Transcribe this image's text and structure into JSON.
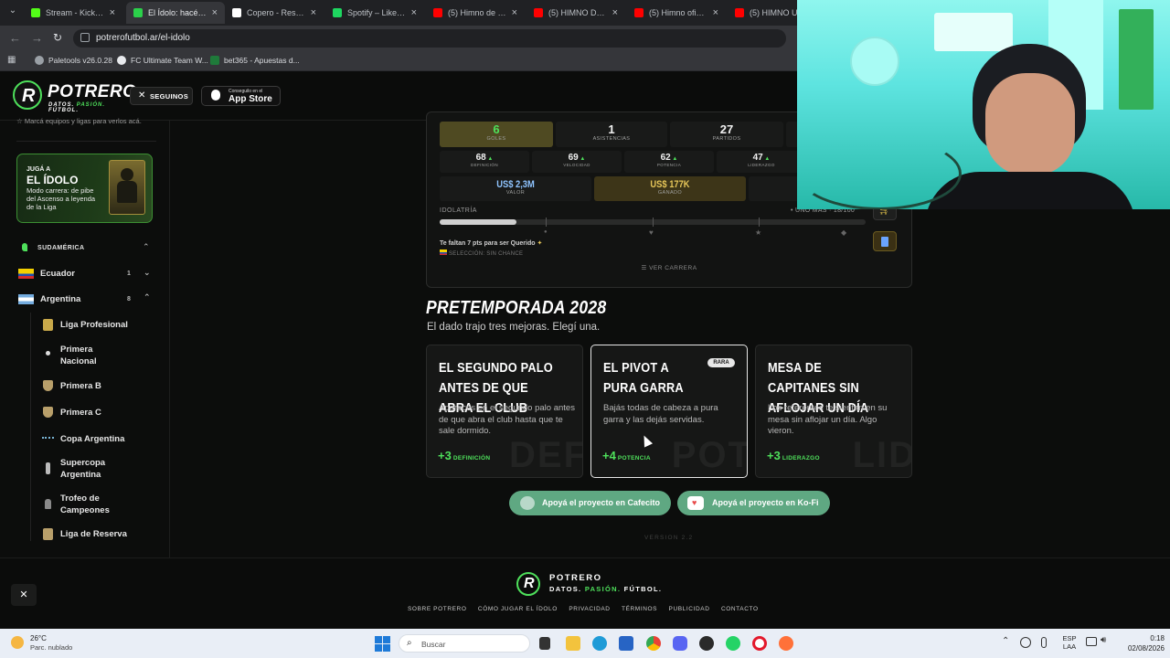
{
  "browser": {
    "tabs": [
      {
        "title": "Stream - Kick Dashboard",
        "icon": "kick-icon",
        "color": "#53fc18"
      },
      {
        "title": "El Ídolo: hacé tu carrera",
        "icon": "potrero-icon",
        "color": "#2bd14a",
        "active": true
      },
      {
        "title": "Copero - Resultados",
        "icon": "copero-icon",
        "color": "#ffffff"
      },
      {
        "title": "Spotify – Liked Songs",
        "icon": "spotify-icon",
        "color": "#1ed760"
      },
      {
        "title": "(5) Himno de la Copa",
        "icon": "youtube-icon",
        "color": "#ff0000"
      },
      {
        "title": "(5) HIMNO DE LA CHAMPIONS",
        "icon": "youtube-icon",
        "color": "#ff0000"
      },
      {
        "title": "(5) Himno oficial",
        "icon": "youtube-icon",
        "color": "#ff0000"
      },
      {
        "title": "(5) HIMNO UEFA",
        "icon": "youtube-icon",
        "color": "#ff0000"
      }
    ],
    "url": "potrerofutbol.ar/el-idolo",
    "bookmarks": [
      {
        "label": "Paletools v26.0.28",
        "color": "#9aa0a6"
      },
      {
        "label": "FC Ultimate Team W...",
        "color": "#e8eaed"
      },
      {
        "label": "bet365 - Apuestas d...",
        "color": "#1f7a3a"
      }
    ]
  },
  "header": {
    "brand": "POTRERO",
    "tagline_a": "DATOS.",
    "tagline_b": "PASIÓN.",
    "tagline_c": "FÚTBOL.",
    "follow": "SEGUINOS",
    "appstore_small": "Conseguilo en el",
    "appstore_big": "App Store"
  },
  "sidebar": {
    "hint": "Marcá equipos y ligas para verlos acá.",
    "promo": {
      "kicker": "JUGÁ A",
      "title": "EL ÍDOLO",
      "text": "Modo carrera: de pibe del Ascenso a leyenda de la Liga"
    },
    "section": "SUDAMÉRICA",
    "countries": [
      {
        "name": "Ecuador",
        "count": "1"
      },
      {
        "name": "Argentina",
        "count": "8"
      }
    ],
    "leagues": [
      "Liga Profesional",
      "Primera Nacional",
      "Primera B",
      "Primera C",
      "Copa Argentina",
      "Supercopa Argentina",
      "Trofeo de Campeones",
      "Liga de Reserva"
    ]
  },
  "stats": {
    "row1": [
      {
        "value": "6",
        "label": "GOLES",
        "highlight": true
      },
      {
        "value": "1",
        "label": "ASISTENCIAS"
      },
      {
        "value": "27",
        "label": "PARTIDOS"
      }
    ],
    "row2": [
      {
        "value": "68",
        "label": "DEFINICIÓN"
      },
      {
        "value": "69",
        "label": "VELOCIDAD"
      },
      {
        "value": "62",
        "label": "POTENCIA"
      },
      {
        "value": "47",
        "label": "LIDERAZGO"
      }
    ],
    "row3": [
      {
        "value": "US$ 2,3M",
        "label": "VALOR"
      },
      {
        "value": "US$ 177K",
        "label": "GANADO"
      }
    ],
    "idolatria_label": "IDOLATRÍA",
    "idolatria_right": "UNO MÁS · 18/100",
    "idolatria_progress": 0.18,
    "message": "Te faltan 7 pts para ser Querido",
    "seleccion": "SELECCIÓN: SIN CHANCE",
    "ver_carrera": "VER CARRERA"
  },
  "pretemporada": {
    "title": "PRETEMPORADA 2028",
    "subtitle": "El dado trajo tres mejoras. Elegí una.",
    "cards": [
      {
        "title": "EL SEGUNDO PALO ANTES DE QUE ABRA EL CLUB",
        "desc": "Aparecés en el segundo palo antes de que abra el club hasta que te sale dormido.",
        "bonus": "+3",
        "attr": "DEFINICIÓN",
        "ghost": "DEF",
        "badge": ""
      },
      {
        "title": "EL PIVOT A PURA GARRA",
        "desc": "Bajás todas de cabeza a pura garra y las dejás servidas.",
        "bonus": "+4",
        "attr": "POTENCIA",
        "ghost": "POT",
        "badge": "RARA"
      },
      {
        "title": "MESA DE CAPITANES SIN AFLOJAR UN DÍA",
        "desc": "Los referentes te sientan en su mesa sin aflojar un día. Algo vieron.",
        "bonus": "+3",
        "attr": "LIDERAZGO",
        "ghost": "LID",
        "badge": ""
      }
    ]
  },
  "support": {
    "cafecito": "Apoyá el proyecto en Cafecito",
    "kofi": "Apoyá el proyecto en Ko-Fi",
    "version": "VERSION 2.2"
  },
  "footer": {
    "brand": "POTRERO",
    "tagline_a": "DATOS.",
    "tagline_b": "PASIÓN.",
    "tagline_c": "FÚTBOL.",
    "links": [
      "SOBRE POTRERO",
      "CÓMO JUGAR EL ÍDOLO",
      "PRIVACIDAD",
      "TÉRMINOS",
      "PUBLICIDAD",
      "CONTACTO"
    ]
  },
  "taskbar": {
    "temp": "26°C",
    "weather": "Parc. nublado",
    "search": "Buscar",
    "lang1": "ESP",
    "lang2": "LAA",
    "time": "0:18",
    "date": "02/08/2026"
  },
  "colors": {
    "accent": "#4ee05b",
    "gold": "#d7b948"
  }
}
